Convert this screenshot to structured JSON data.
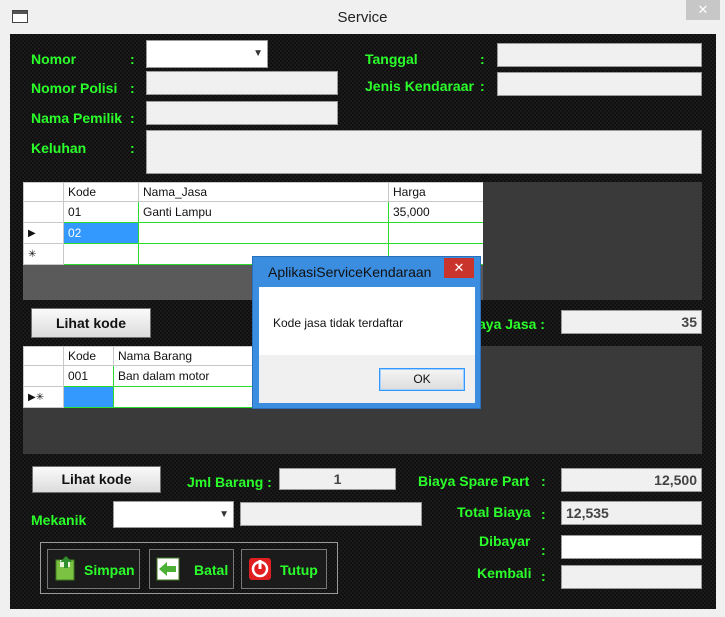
{
  "window": {
    "title": "Service",
    "close_glyph": "✕"
  },
  "form": {
    "nomor_label": "Nomor",
    "nomor_polisi_label": "Nomor Polisi",
    "nama_pemilik_label": "Nama Pemilik",
    "keluhan_label": "Keluhan",
    "tanggal_label": "Tanggal",
    "jenis_kendaraan_label": "Jenis Kendaraar",
    "colon": ":",
    "nomor_value": "",
    "nomor_polisi_value": "",
    "nama_pemilik_value": "",
    "keluhan_value": "",
    "tanggal_value": "",
    "jenis_kendaraan_value": ""
  },
  "jasa_grid": {
    "headers": [
      "Kode",
      "Nama_Jasa",
      "Harga"
    ],
    "rows": [
      {
        "indicator": "",
        "kode": "01",
        "nama": "Ganti Lampu",
        "harga": "35,000"
      },
      {
        "indicator": "▶",
        "kode": "02",
        "nama": "",
        "harga": ""
      },
      {
        "indicator": "✳",
        "kode": "",
        "nama": "",
        "harga": ""
      }
    ]
  },
  "lihat_kode_jasa_label": "Lihat kode",
  "biaya_jasa": {
    "label": "aya Jasa :",
    "value": "35"
  },
  "barang_grid": {
    "headers": [
      "Kode",
      "Nama Barang"
    ],
    "rows": [
      {
        "indicator": "",
        "kode": "001",
        "nama": "Ban dalam motor"
      },
      {
        "indicator": "▶✳",
        "kode": "",
        "nama": ""
      }
    ]
  },
  "lihat_kode_barang_label": "Lihat kode",
  "jml_barang": {
    "label": "Jml Barang :",
    "value": "1"
  },
  "mekanik": {
    "label": "Mekanik",
    "value": "",
    "name_value": ""
  },
  "totals": {
    "biaya_spare_part_label": "Biaya Spare Part",
    "biaya_spare_part_value": "12,500",
    "total_biaya_label": "Total Biaya",
    "total_biaya_value": "12,535",
    "dibayar_label": "Dibayar",
    "dibayar_value": "",
    "kembali_label": "Kembali",
    "kembali_value": "",
    "colon": ":"
  },
  "actions": {
    "simpan": "Simpan",
    "batal": "Batal",
    "tutup": "Tutup"
  },
  "dialog": {
    "title": "AplikasiServiceKendaraan",
    "message": "Kode jasa tidak terdaftar",
    "ok_label": "OK",
    "close_glyph": "✕"
  },
  "colors": {
    "label_green": "#2bff2b",
    "selection_blue": "#3399ff",
    "dialog_border": "#3b8de0",
    "close_red": "#c9352c"
  }
}
